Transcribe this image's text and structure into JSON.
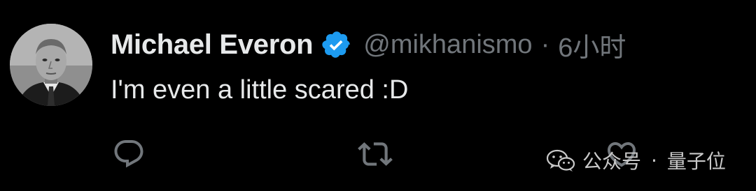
{
  "tweet": {
    "author_name": "Michael Everon",
    "handle": "@mikhanismo",
    "separator": "·",
    "time": "6小时",
    "text": "I'm even a little scared :D",
    "verified_color": "#1d9bf0"
  },
  "actions": {
    "reply_icon": "reply-icon",
    "retweet_icon": "retweet-icon",
    "like_icon": "heart-icon",
    "icon_color": "#71767b"
  },
  "watermark": {
    "label": "公众号",
    "dot": "·",
    "name": "量子位"
  }
}
